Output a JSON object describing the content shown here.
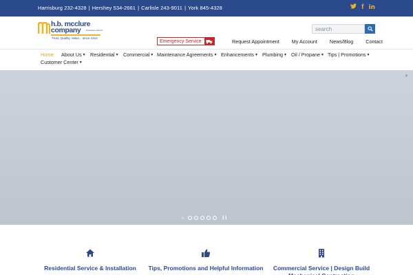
{
  "topbar": {
    "phones": [
      "Harrisburg 232-4328",
      "Hershey 534-2661",
      "Carlisle 243-9011",
      "York 845-4328"
    ],
    "separator": "|",
    "social": [
      "twitter-icon",
      "facebook-icon",
      "linkedin-icon"
    ],
    "social_glyphs": {
      "twitter": "✦",
      "facebook": "f",
      "linkedin": "in"
    }
  },
  "logo": {
    "line1": "h.b. mcclure",
    "line2": "company",
    "employee_owned": "Employee Owned",
    "tagline": "Trust, Quality, Value... since 1914"
  },
  "search": {
    "placeholder": "search"
  },
  "emergency": {
    "label": "Emergency Service"
  },
  "header_links": [
    "Request Appointment",
    "My Account",
    "News/Blog",
    "Contact"
  ],
  "nav": {
    "items": [
      {
        "label": "Home",
        "active": true,
        "dropdown": false
      },
      {
        "label": "About Us",
        "dropdown": true
      },
      {
        "label": "Residential",
        "dropdown": true
      },
      {
        "label": "Commercial",
        "dropdown": true
      },
      {
        "label": "Maintenance Agreements",
        "dropdown": true
      },
      {
        "label": "Enhancements",
        "dropdown": true
      },
      {
        "label": "Plumbing",
        "dropdown": true
      },
      {
        "label": "Oil / Propane",
        "dropdown": true
      },
      {
        "label": "Tips | Promotions",
        "dropdown": true
      },
      {
        "label": "Customer Center",
        "dropdown": true
      }
    ]
  },
  "hero": {
    "close": "✕",
    "slides": 5,
    "active_slide": 1,
    "prev": "›",
    "pause": "❙❙"
  },
  "services": [
    {
      "icon": "home-icon",
      "title": "Residential Service & Installation"
    },
    {
      "icon": "thumbs-up-icon",
      "title": "Tips, Promotions and Helpful Information"
    },
    {
      "icon": "building-icon",
      "title": "Commercial Service | Design Build Mechanical Contracting"
    }
  ],
  "colors": {
    "brand_blue": "#2b4a8b",
    "accent_gold": "#f0b323",
    "emergency_red": "#c62828",
    "hero_gray": "#c7cdd6"
  }
}
